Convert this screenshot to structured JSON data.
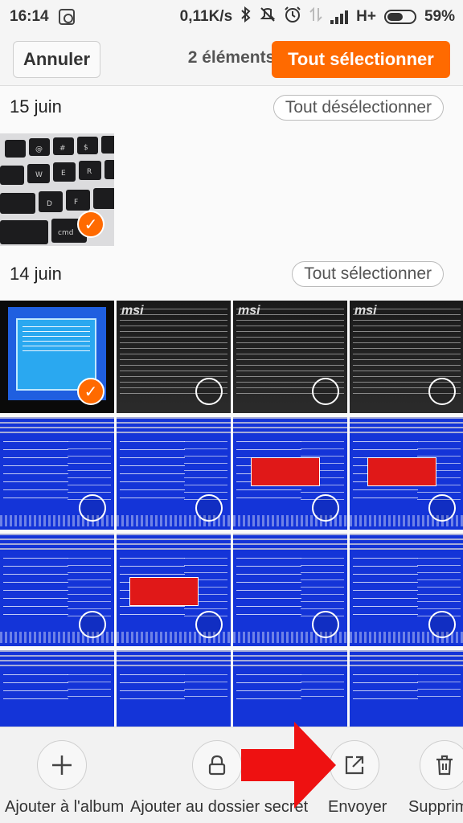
{
  "status_bar": {
    "time": "16:14",
    "network_speed": "0,11K/s",
    "network_type": "H+",
    "battery": "59%",
    "battery_level": 0.59,
    "icons": [
      "screenshot-app-icon",
      "bluetooth-icon",
      "mute-icon",
      "alarm-icon",
      "data-transfer-icon",
      "signal-icon",
      "battery-icon"
    ]
  },
  "action_bar": {
    "cancel_label": "Annuler",
    "count_label": "2 éléments",
    "select_all_label": "Tout sélectionner",
    "accent_color": "#ff6a00"
  },
  "sections": [
    {
      "date": "15 juin",
      "action_label": "Tout désélectionner",
      "photos": [
        {
          "kind": "keyboard",
          "selected": true
        }
      ]
    },
    {
      "date": "14 juin",
      "action_label": "Tout sélectionner",
      "photos": [
        {
          "kind": "boot-menu",
          "selected": true
        },
        {
          "kind": "msi-post",
          "selected": false
        },
        {
          "kind": "msi-post",
          "selected": false
        },
        {
          "kind": "msi-post",
          "selected": false
        },
        {
          "kind": "bios-boot",
          "selected": false
        },
        {
          "kind": "bios-boot",
          "selected": false
        },
        {
          "kind": "bios-boot-dialog",
          "selected": false
        },
        {
          "kind": "bios-boot-dialog",
          "selected": false
        },
        {
          "kind": "bios-boot",
          "selected": false
        },
        {
          "kind": "bios-boot-dialog",
          "selected": false
        },
        {
          "kind": "bios-boot",
          "selected": false
        },
        {
          "kind": "bios-advanced",
          "selected": false
        },
        {
          "kind": "bios-main",
          "selected": false
        },
        {
          "kind": "bios-main",
          "selected": false
        },
        {
          "kind": "bios-main",
          "selected": false
        },
        {
          "kind": "bios-main",
          "selected": false
        }
      ]
    }
  ],
  "bottom_bar": {
    "items": [
      {
        "label": "Ajouter à l'album",
        "icon": "plus-icon"
      },
      {
        "label": "Ajouter au dossier secret",
        "icon": "lock-icon"
      },
      {
        "label": "Envoyer",
        "icon": "share-icon"
      },
      {
        "label": "Supprim",
        "icon": "trash-icon"
      }
    ]
  }
}
